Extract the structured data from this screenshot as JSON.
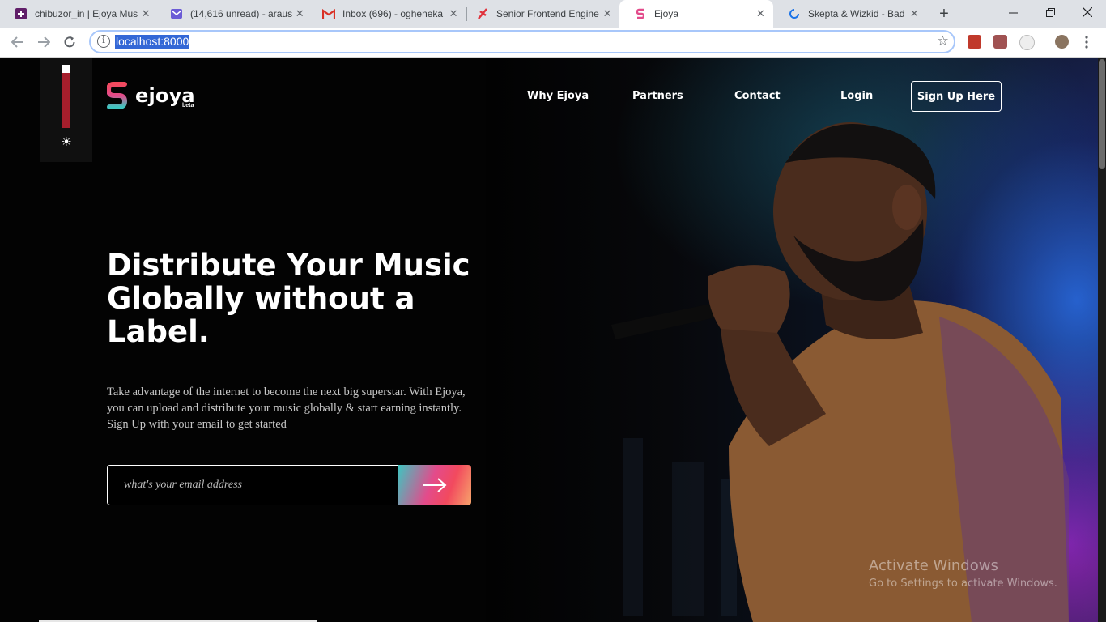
{
  "browser": {
    "tabs": [
      {
        "title": "chibuzor_in | Ejoya Mus",
        "icon": "slack-icon",
        "color": "#611f69"
      },
      {
        "title": "(14,616 unread) - araus",
        "icon": "mail-icon",
        "color": "#6b5bd6"
      },
      {
        "title": "Inbox (696) - ogheneka",
        "icon": "gmail-icon",
        "color": "#d93025"
      },
      {
        "title": "Senior Frontend Engine",
        "icon": "job-icon",
        "color": "#e0323c"
      },
      {
        "title": "Ejoya",
        "icon": "ejoya-icon",
        "color": "#e34b8b",
        "active": true
      },
      {
        "title": "Skepta & Wizkid - Bad",
        "icon": "loading-icon",
        "color": "#1a73e8"
      }
    ],
    "url": "localhost:8000"
  },
  "brand": {
    "name": "ejoya",
    "badge": "beta",
    "accent_colors": [
      "#3ec5c0",
      "#e34b8b",
      "#f24a5e"
    ]
  },
  "nav": {
    "items": [
      "Why Ejoya",
      "Partners",
      "Contact",
      "Login"
    ],
    "cta": "Sign Up Here"
  },
  "hero": {
    "headline": "Distribute Your Music Globally without a Label.",
    "description": "Take advantage of the internet to become the next big superstar. With Ejoya, you can upload and distribute your music globally & start earning instantly. Sign Up with your email to get started",
    "email_placeholder": "what's your email address"
  },
  "watermark": {
    "title": "Activate Windows",
    "subtitle": "Go to Settings to activate Windows."
  }
}
